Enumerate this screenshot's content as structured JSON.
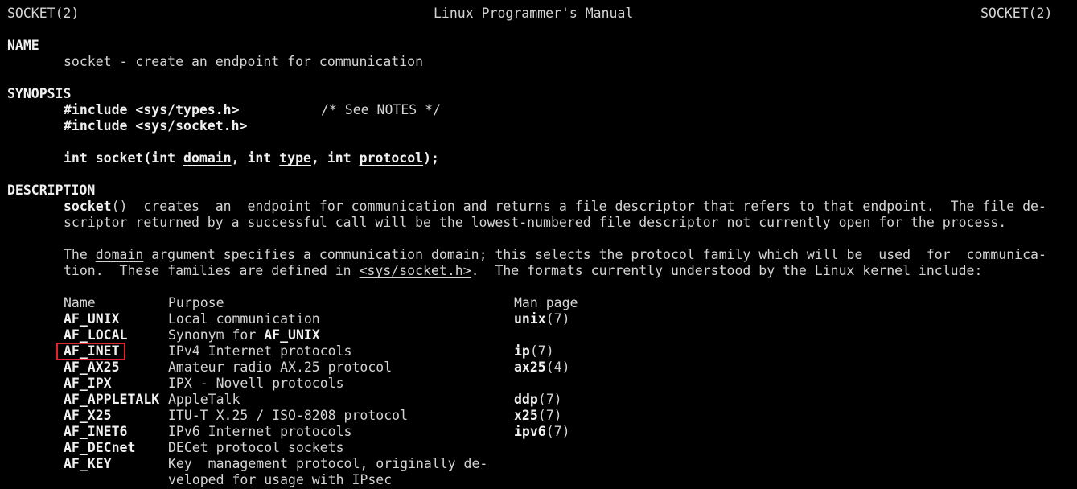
{
  "header": {
    "left": "SOCKET(2)",
    "center": "Linux Programmer's Manual",
    "right": "SOCKET(2)"
  },
  "name": {
    "heading": "NAME",
    "text": "socket - create an endpoint for communication"
  },
  "synopsis": {
    "heading": "SYNOPSIS",
    "include1": "#include <sys/types.h>",
    "include1_comment": "/* See NOTES */",
    "include2": "#include <sys/socket.h>",
    "proto_1": "int socket(int ",
    "proto_domain": "domain",
    "proto_2": ", int ",
    "proto_type": "type",
    "proto_3": ", int ",
    "proto_protocol": "protocol",
    "proto_4": ");"
  },
  "description": {
    "heading": "DESCRIPTION",
    "p1_fn": "socket",
    "p1_l1": "()  creates  an  endpoint for communication and returns a file descriptor that refers to that endpoint.  The file de-",
    "p1_l2": "scriptor returned by a successful call will be the lowest-numbered file descriptor not currently open for the process.",
    "p2_l1_a": "The ",
    "p2_l1_domain": "domain",
    "p2_l1_b": " argument specifies a communication domain; this selects the protocol family which will be  used  for  communica-",
    "p2_l2_a": "tion.  These families are defined in ",
    "p2_l2_header": "<sys/socket.h>",
    "p2_l2_b": ".  The formats currently understood by the Linux kernel include:"
  },
  "table": {
    "headers": [
      "Name",
      "Purpose",
      "Man page"
    ],
    "rows": [
      {
        "name": "AF_UNIX",
        "purpose": "Local communication",
        "purpose_b": "",
        "man": "unix",
        "sect": "(7)"
      },
      {
        "name": "AF_LOCAL",
        "purpose": "Synonym for ",
        "purpose_b": "AF_UNIX",
        "man": "",
        "sect": ""
      },
      {
        "name": "AF_INET",
        "purpose": "IPv4 Internet protocols",
        "purpose_b": "",
        "man": "ip",
        "sect": "(7)"
      },
      {
        "name": "AF_AX25",
        "purpose": "Amateur radio AX.25 protocol",
        "purpose_b": "",
        "man": "ax25",
        "sect": "(4)"
      },
      {
        "name": "AF_IPX",
        "purpose": "IPX - Novell protocols",
        "purpose_b": "",
        "man": "",
        "sect": ""
      },
      {
        "name": "AF_APPLETALK",
        "purpose": "AppleTalk",
        "purpose_b": "",
        "man": "ddp",
        "sect": "(7)"
      },
      {
        "name": "AF_X25",
        "purpose": "ITU-T X.25 / ISO-8208 protocol",
        "purpose_b": "",
        "man": "x25",
        "sect": "(7)"
      },
      {
        "name": "AF_INET6",
        "purpose": "IPv6 Internet protocols",
        "purpose_b": "",
        "man": "ipv6",
        "sect": "(7)"
      },
      {
        "name": "AF_DECnet",
        "purpose": "DECet protocol sockets",
        "purpose_b": "",
        "man": "",
        "sect": ""
      },
      {
        "name": "AF_KEY",
        "purpose": "Key  management protocol, originally de-",
        "purpose_b": "",
        "man": "",
        "sect": ""
      }
    ],
    "continuation": "veloped for usage with IPsec"
  },
  "colors": {
    "background": "#000000",
    "text": "#d4d4d4",
    "highlight": "#e0242f"
  }
}
